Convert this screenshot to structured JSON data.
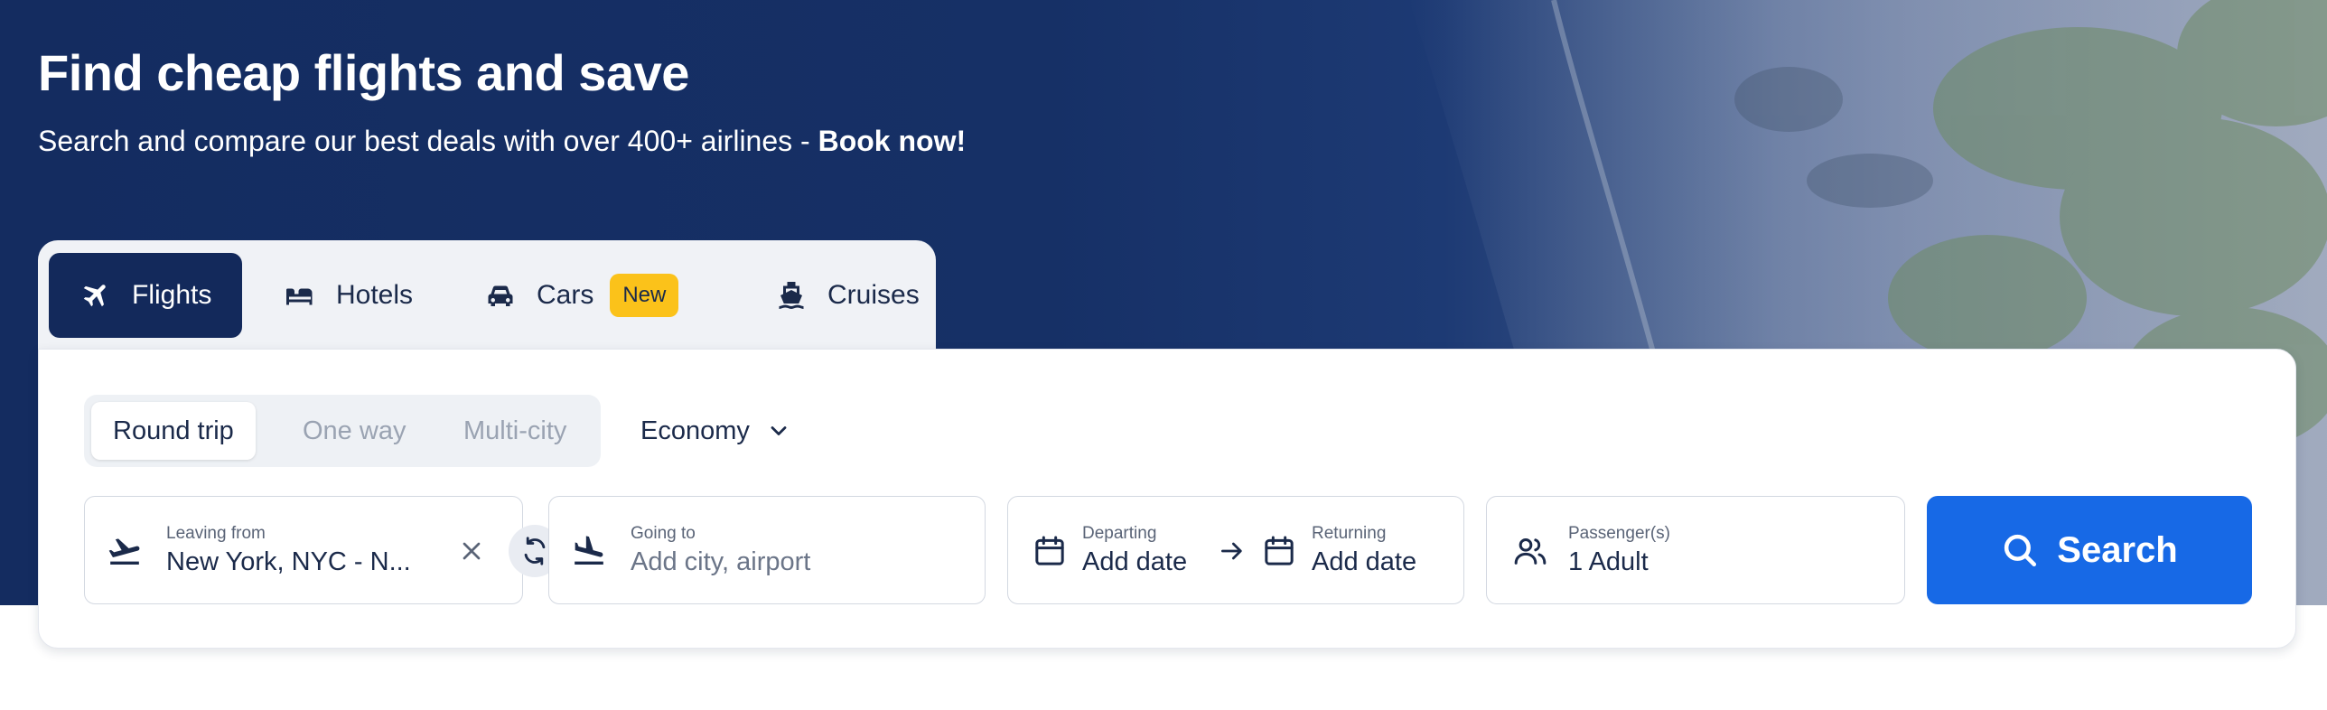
{
  "hero": {
    "title": "Find cheap flights and save",
    "subtitle_prefix": "Search and compare our best deals with over 400+ airlines - ",
    "subtitle_cta": "Book now!"
  },
  "tabs": [
    {
      "label": "Flights",
      "icon": "plane-icon",
      "active": true
    },
    {
      "label": "Hotels",
      "icon": "bed-icon",
      "active": false
    },
    {
      "label": "Cars",
      "icon": "car-icon",
      "active": false,
      "badge": "New"
    },
    {
      "label": "Cruises",
      "icon": "ship-icon",
      "active": false
    }
  ],
  "trip_types": [
    {
      "label": "Round trip",
      "selected": true
    },
    {
      "label": "One way",
      "selected": false
    },
    {
      "label": "Multi-city",
      "selected": false
    }
  ],
  "cabin_class": "Economy",
  "fields": {
    "origin": {
      "label": "Leaving from",
      "value": "New York, NYC - N..."
    },
    "destination": {
      "label": "Going to",
      "placeholder": "Add city, airport"
    },
    "departing": {
      "label": "Departing",
      "value": "Add date"
    },
    "returning": {
      "label": "Returning",
      "value": "Add date"
    },
    "passengers": {
      "label": "Passenger(s)",
      "value": "1 Adult"
    }
  },
  "search_label": "Search",
  "colors": {
    "hero_navy": "#142c60",
    "active_tab": "#13295b",
    "badge": "#fbc21a",
    "primary": "#1769e6"
  }
}
